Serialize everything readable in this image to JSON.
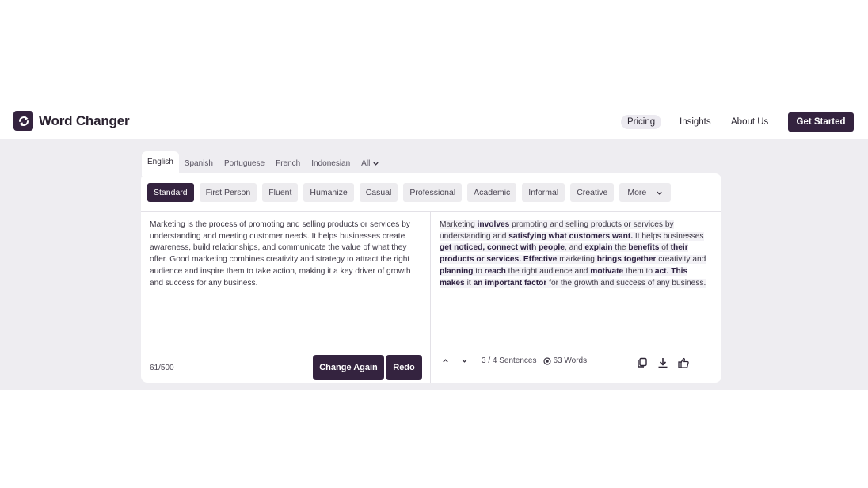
{
  "header": {
    "logo_text": "Word Changer",
    "nav": {
      "pricing": "Pricing",
      "insights": "Insights",
      "about": "About Us"
    },
    "cta": "Get Started"
  },
  "languages": {
    "tabs": [
      "English",
      "Spanish",
      "Portuguese",
      "French",
      "Indonesian"
    ],
    "all_label": "All",
    "active": "English"
  },
  "modes": {
    "items": [
      "Standard",
      "First Person",
      "Fluent",
      "Humanize",
      "Casual",
      "Professional",
      "Academic",
      "Informal",
      "Creative"
    ],
    "more_label": "More",
    "active": "Standard"
  },
  "input": {
    "text": "Marketing is the process of promoting and selling products or services by understanding and meeting customer needs. It helps businesses create awareness, build relationships, and communicate the value of what they offer. Good marketing combines creativity and strategy to attract the right audience and inspire them to take action, making it a key driver of growth and success for any business.",
    "counter": "61/500",
    "change_again": "Change Again",
    "redo": "Redo"
  },
  "output": {
    "segments": [
      {
        "t": "Marketing ",
        "b": false
      },
      {
        "t": "involves",
        "b": true
      },
      {
        "t": " promoting and selling products or services by understanding and ",
        "b": false
      },
      {
        "t": "satisfying what customers want.",
        "b": true
      },
      {
        "t": " It helps businesses ",
        "b": false
      },
      {
        "t": "get noticed, connect with people",
        "b": true
      },
      {
        "t": ", and ",
        "b": false
      },
      {
        "t": "explain",
        "b": true
      },
      {
        "t": " the ",
        "b": false
      },
      {
        "t": "benefits",
        "b": true
      },
      {
        "t": " of ",
        "b": false
      },
      {
        "t": "their products or services. Effective",
        "b": true
      },
      {
        "t": " marketing ",
        "b": false
      },
      {
        "t": "brings together",
        "b": true
      },
      {
        "t": " creativity and ",
        "b": false
      },
      {
        "t": "planning",
        "b": true
      },
      {
        "t": " to ",
        "b": false
      },
      {
        "t": "reach",
        "b": true
      },
      {
        "t": " the right audience and ",
        "b": false
      },
      {
        "t": "motivate",
        "b": true
      },
      {
        "t": " them to ",
        "b": false
      },
      {
        "t": "act. This makes",
        "b": true
      },
      {
        "t": " it ",
        "b": false
      },
      {
        "t": "an important factor",
        "b": true
      },
      {
        "t": " for the growth and success of any business.",
        "b": false
      }
    ],
    "sentences": "3 / 4 Sentences",
    "words": "63 Words"
  },
  "colors": {
    "brand": "#34233f",
    "background": "#eeedf1"
  },
  "icons": [
    "logo-icon",
    "chevron-down-icon",
    "chevron-up-icon",
    "eye-icon",
    "copy-icon",
    "download-icon",
    "thumbs-up-icon"
  ]
}
